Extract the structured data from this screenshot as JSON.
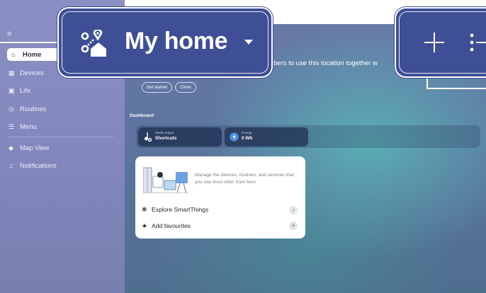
{
  "header": {
    "location_name": "My home"
  },
  "sidebar": {
    "items": [
      {
        "label": "Home",
        "icon": "home-icon"
      },
      {
        "label": "Devices",
        "icon": "devices-icon"
      },
      {
        "label": "Life",
        "icon": "life-icon"
      },
      {
        "label": "Routines",
        "icon": "routines-icon"
      },
      {
        "label": "Menu",
        "icon": "menu-icon"
      },
      {
        "label": "Map View",
        "icon": "map-view-icon"
      },
      {
        "label": "Notifications",
        "icon": "bell-icon"
      }
    ]
  },
  "banner": {
    "text": "bers to use this location together w",
    "get_started": "Get started",
    "close": "Close"
  },
  "dashboard": {
    "label": "Dashboard",
    "cards": [
      {
        "sub": "Media output",
        "main": "Shortcuts",
        "icon": "music-note-icon"
      },
      {
        "sub": "Energy",
        "main": "0 Wh",
        "icon": "energy-icon"
      }
    ]
  },
  "favourites_card": {
    "description": "Manage the devices, routines, and services that you use most often from here.",
    "rows": [
      {
        "label": "Explore SmartThings",
        "icon": "smartthings-icon",
        "action_icon": "chevron-right-icon"
      },
      {
        "label": "Add favourites",
        "icon": "star-icon",
        "action_icon": "plus-icon"
      }
    ]
  },
  "colors": {
    "callout": "#3f4f96",
    "sidebar": "#8a8fc4",
    "accent_teal": "#5ab9b9"
  }
}
